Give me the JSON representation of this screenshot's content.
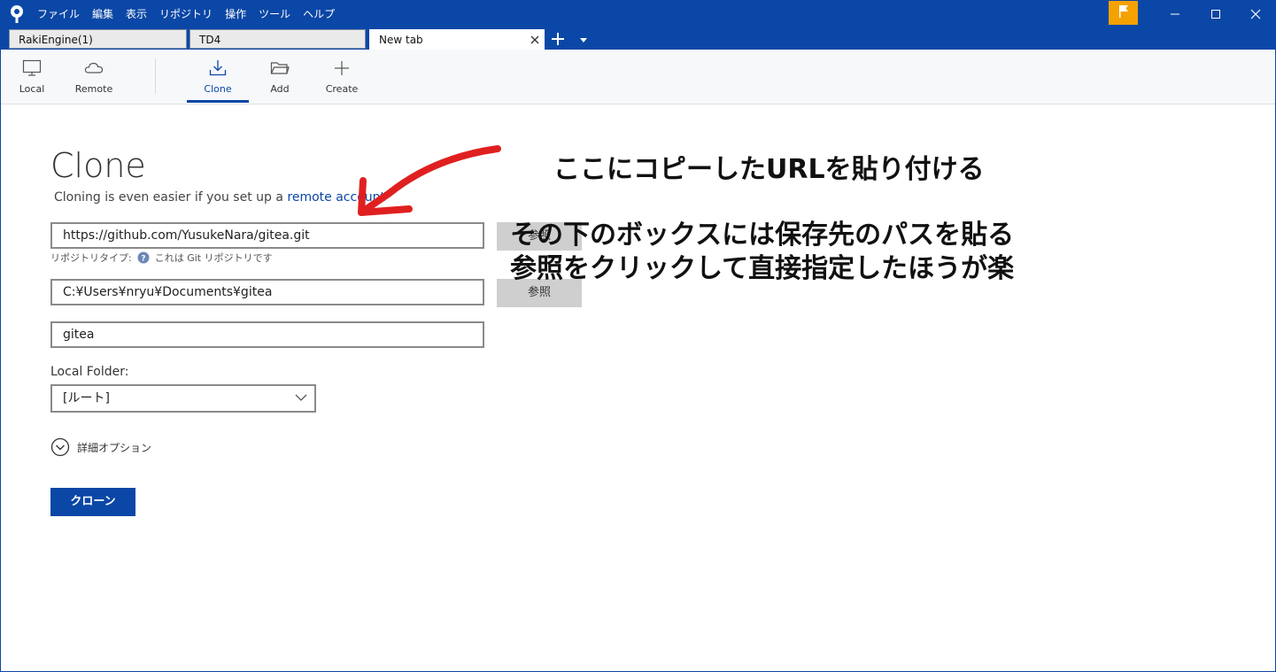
{
  "menu": [
    "ファイル",
    "編集",
    "表示",
    "リポジトリ",
    "操作",
    "ツール",
    "ヘルプ"
  ],
  "tabs": [
    {
      "label": "RakiEngine(1)"
    },
    {
      "label": "TD4"
    },
    {
      "label": "New tab"
    }
  ],
  "toolbar": {
    "local": "Local",
    "remote": "Remote",
    "clone": "Clone",
    "add": "Add",
    "create": "Create"
  },
  "page": {
    "title": "Clone",
    "subtitle_prefix": "Cloning is even easier if you set up a ",
    "subtitle_link": "remote account"
  },
  "form": {
    "source_url": "https://github.com/YusukeNara/gitea.git",
    "browse_label": "参照",
    "repo_type_label": "リポジトリタイプ:",
    "repo_type_value": "これは Git リポジトリです",
    "destination_path": "C:¥Users¥nryu¥Documents¥gitea",
    "name": "gitea",
    "local_folder_label": "Local Folder:",
    "local_folder_value": "[ルート]",
    "advanced_label": "詳細オプション",
    "clone_button": "クローン"
  },
  "annotations": {
    "line1": "ここにコピーしたURLを貼り付ける",
    "line2": "その下のボックスには保存先のパスを貼る",
    "line3": "参照をクリックして直接指定したほうが楽"
  },
  "colors": {
    "accent": "#0b47a6",
    "flag": "#f5a100",
    "annotation_arrow": "#e02020"
  }
}
